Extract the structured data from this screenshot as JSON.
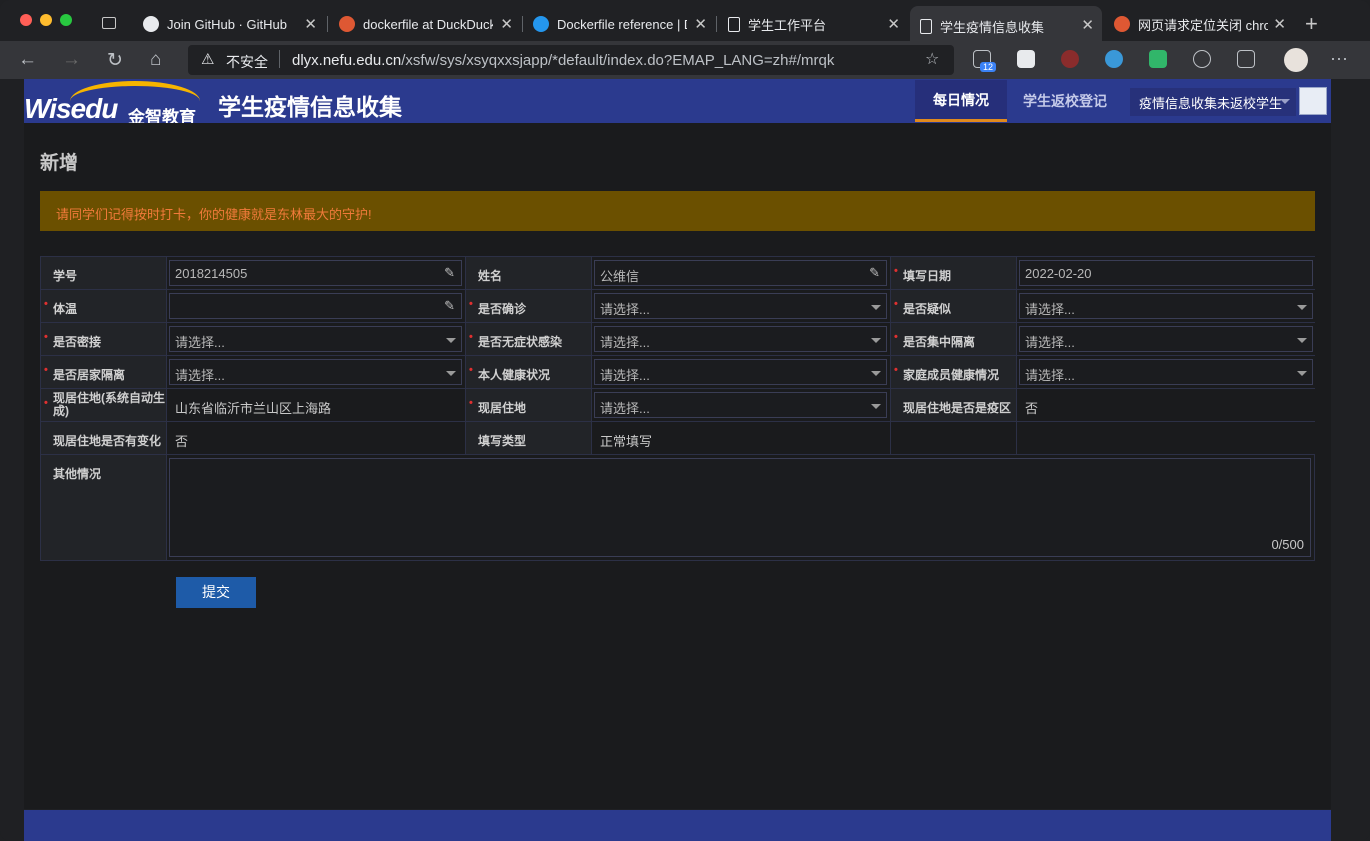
{
  "browser": {
    "tabs": [
      {
        "title": "Join GitHub · GitHub",
        "icon": "github-icon"
      },
      {
        "title": "dockerfile at DuckDuckGo",
        "icon": "duckduckgo-icon"
      },
      {
        "title": "Dockerfile reference | Docker",
        "icon": "docker-icon"
      },
      {
        "title": "学生工作平台",
        "icon": "page-icon"
      },
      {
        "title": "学生疫情信息收集",
        "icon": "page-icon"
      },
      {
        "title": "网页请求定位关闭 chrome",
        "icon": "duckduckgo-icon"
      }
    ],
    "security_label": "不安全",
    "url_host": "dlyx.nefu.edu.cn",
    "url_path": "/xsfw/sys/xsyqxxsjapp/*default/index.do?EMAP_LANG=zh#/mrqk",
    "badge_count": "12"
  },
  "app": {
    "logo_text": "Wisedu",
    "logo_cn": "金智教育",
    "title": "学生疫情信息收集",
    "nav": [
      "每日情况",
      "学生返校登记"
    ],
    "role": "疫情信息收集未返校学生"
  },
  "form": {
    "heading": "新增",
    "notice": "请同学们记得按时打卡，你的健康就是东林最大的守护!",
    "student_id_label": "学号",
    "student_id": "2018214505",
    "name_label": "姓名",
    "name": "公维信",
    "date_label": "填写日期",
    "date": "2022-02-20",
    "temp_label": "体温",
    "confirmed_label": "是否确诊",
    "suspected_label": "是否疑似",
    "contact_label": "是否密接",
    "asymptomatic_label": "是否无症状感染",
    "central_iso_label": "是否集中隔离",
    "home_iso_label": "是否居家隔离",
    "health_label": "本人健康状况",
    "family_health_label": "家庭成员健康情况",
    "placeholder": "请选择...",
    "residence_auto_label": "现居住地(系统自动生成)",
    "residence_auto": "山东省临沂市兰山区上海路",
    "residence_label": "现居住地",
    "epidemic_area_label": "现居住地是否是疫区",
    "epidemic_area": "否",
    "changed_label": "现居住地是否有变化",
    "changed": "否",
    "fill_type_label": "填写类型",
    "fill_type": "正常填写",
    "other_label": "其他情况",
    "counter": "0/500",
    "submit": "提交"
  }
}
